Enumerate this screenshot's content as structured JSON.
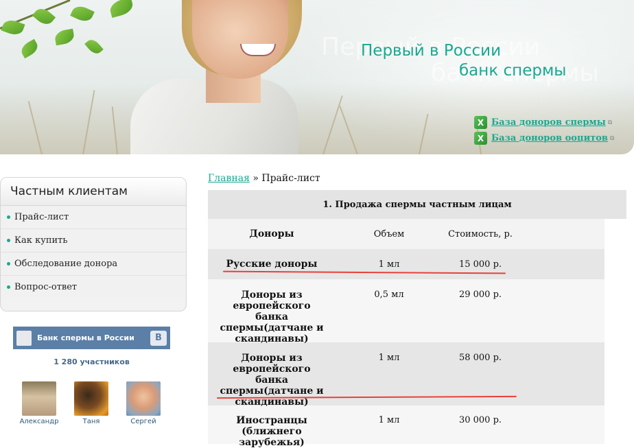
{
  "header": {
    "slogan_line1": "Первый в России",
    "slogan_line2": "банк спермы",
    "links": [
      {
        "label": "База доноров спермы",
        "icon": "excel-icon"
      },
      {
        "label": "База доноров ооцитов",
        "icon": "excel-icon"
      }
    ]
  },
  "sidebar": {
    "title": "Частным клиентам",
    "items": [
      {
        "label": "Прайс-лист"
      },
      {
        "label": "Как купить"
      },
      {
        "label": "Обследование донора"
      },
      {
        "label": "Вопрос-ответ"
      }
    ]
  },
  "vk": {
    "group_name": "Банк спермы в России",
    "badge": "B",
    "members_count": "1 280 участников",
    "members": [
      {
        "name": "Александр"
      },
      {
        "name": "Таня"
      },
      {
        "name": "Сергей"
      }
    ]
  },
  "breadcrumb": {
    "home": "Главная",
    "separator": "»",
    "current": "Прайс-лист"
  },
  "price_table": {
    "section_title": "1. Продажа спермы частным лицам",
    "columns": [
      "Доноры",
      "Объем",
      "Стоимость, р."
    ],
    "rows": [
      {
        "donors": "Русские доноры",
        "volume": "1 мл",
        "price": "15 000 р."
      },
      {
        "donors": "Доноры из европейского банка спермы(датчане и скандинавы)",
        "volume": "0,5 мл",
        "price": "29 000 р."
      },
      {
        "donors": "Доноры из европейского банка спермы(датчане и скандинавы)",
        "volume": "1 мл",
        "price": "58 000 р."
      },
      {
        "donors": "Иностранцы (ближнего зарубежья)",
        "volume": "1 мл",
        "price": "30 000 р."
      }
    ]
  },
  "colors": {
    "accent": "#1aa88f",
    "highlight_line": "#e8403a",
    "vk_blue": "#5b7fa6"
  }
}
